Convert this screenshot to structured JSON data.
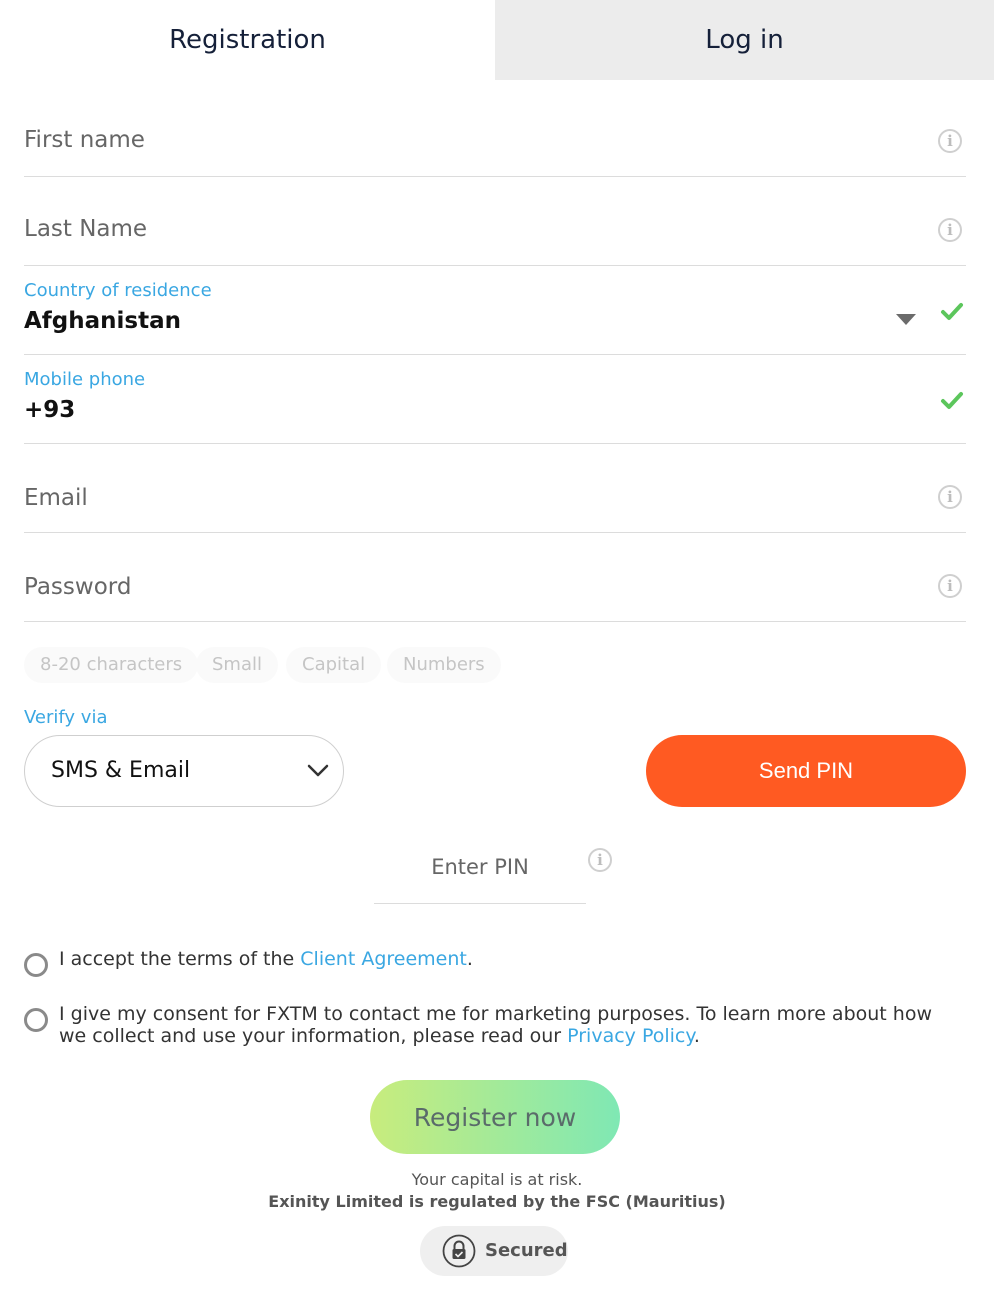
{
  "tabs": {
    "registration": "Registration",
    "login": "Log in"
  },
  "form": {
    "first_name": {
      "placeholder": "First name"
    },
    "last_name": {
      "placeholder": "Last Name"
    },
    "country": {
      "label": "Country of residence",
      "value": "Afghanistan"
    },
    "mobile": {
      "label": "Mobile phone",
      "value": "+93"
    },
    "email": {
      "placeholder": "Email"
    },
    "password": {
      "placeholder": "Password"
    },
    "password_hints": [
      "8-20 characters",
      "Small",
      "Capital",
      "Numbers"
    ],
    "verify": {
      "label": "Verify via",
      "value": "SMS & Email"
    },
    "send_pin": "Send PIN",
    "enter_pin": {
      "placeholder": "Enter PIN"
    }
  },
  "consents": {
    "terms": {
      "text": "I accept the terms of the ",
      "link": "Client Agreement",
      "suffix": "."
    },
    "marketing": {
      "line1": "I give my consent for FXTM to contact me for marketing purposes. To learn more about how",
      "line2": "we collect and use your information, please read our ",
      "link": "Privacy Policy",
      "suffix": "."
    }
  },
  "register_button": "Register now",
  "footer": {
    "risk": "Your capital is at risk.",
    "regulation": "Exinity Limited is regulated by the FSC (Mauritius)",
    "secured": "Secured"
  },
  "colors": {
    "accent_blue": "#3aa7e2",
    "send_pin": "#ff5a22",
    "check_green": "#5cc65c"
  }
}
